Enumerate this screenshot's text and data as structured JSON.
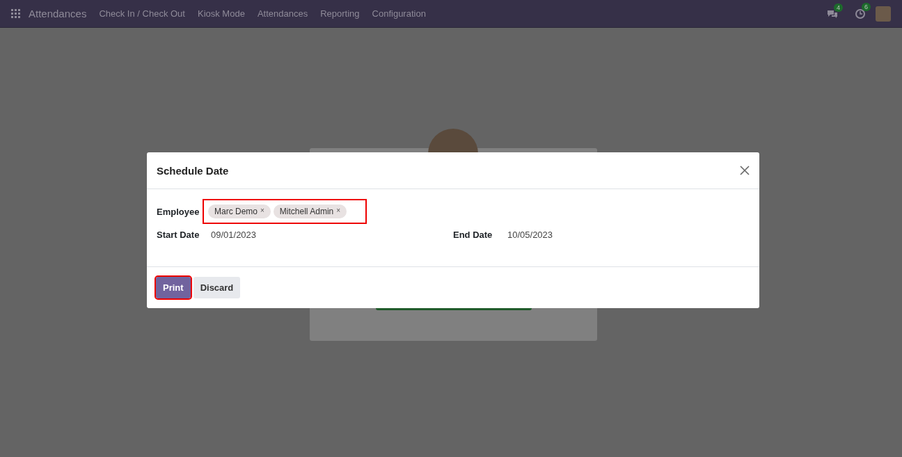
{
  "navbar": {
    "app_name": "Attendances",
    "menu": [
      "Check In / Check Out",
      "Kiosk Mode",
      "Attendances",
      "Reporting",
      "Configuration"
    ],
    "messages_badge": "4",
    "activities_badge": "6"
  },
  "dialog": {
    "title": "Schedule Date",
    "employee": {
      "label": "Employee",
      "highlighted": true,
      "tags": [
        {
          "name": "Marc Demo",
          "remove": "×"
        },
        {
          "name": "Mitchell Admin",
          "remove": "×"
        }
      ]
    },
    "start_date": {
      "label": "Start Date",
      "value": "09/01/2023"
    },
    "end_date": {
      "label": "End Date",
      "value": "10/05/2023"
    },
    "buttons": [
      {
        "label": "Print",
        "kind": "primary",
        "highlighted": true
      },
      {
        "label": "Discard",
        "kind": "secondary",
        "highlighted": false
      }
    ]
  }
}
